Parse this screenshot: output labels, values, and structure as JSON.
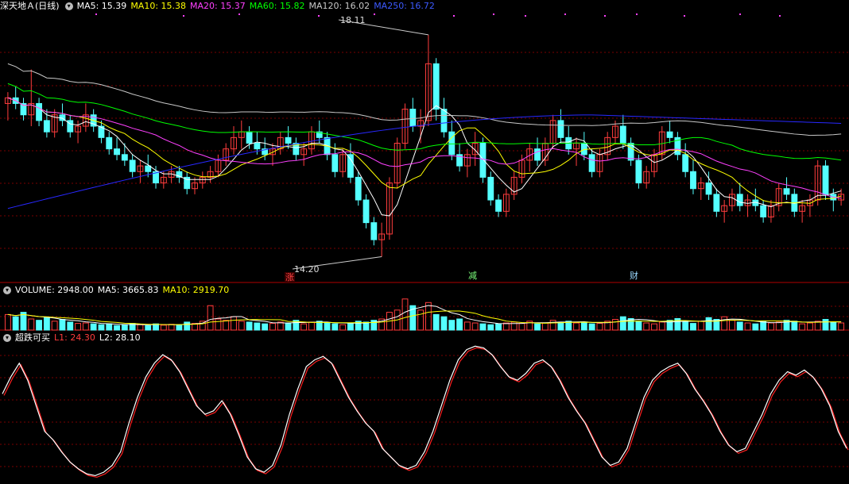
{
  "header": {
    "stock_name": "深天地Ａ",
    "period": "(日线)",
    "ma5": "MA5: 15.39",
    "ma10": "MA10: 15.38",
    "ma20": "MA20: 15.37",
    "ma60": "MA60: 15.82",
    "ma120": "MA120: 16.02",
    "ma250": "MA250: 16.72"
  },
  "volume_header": {
    "title": "VOLUME: 2948.00",
    "ma5": "MA5: 3665.83",
    "ma10": "MA10: 2919.70"
  },
  "indicator_header": {
    "title": "超跌可买",
    "l1": "L1: 24.30",
    "l2": "L2: 28.10"
  },
  "price_labels": {
    "high": "18.11",
    "low": "14.20"
  },
  "events": [
    {
      "label": "涨",
      "color": "#ff4444"
    },
    {
      "label": "减",
      "color": "#7cff7c"
    },
    {
      "label": "财",
      "color": "#9ad8ff"
    }
  ],
  "colors": {
    "up": "#ff3d3d",
    "down": "#54ffff",
    "ma5": "#ffffff",
    "ma10": "#ffff00",
    "ma20": "#ff40ff",
    "ma60": "#00ff00",
    "ma120": "#c8c8c8",
    "ma250": "#2828ff",
    "grid": "#7a0000"
  },
  "chart_data": {
    "type": "candlestick",
    "price_range": [
      13.9,
      18.5
    ],
    "high": 18.11,
    "low": 14.2,
    "candles": [
      [
        16.9,
        17.1,
        16.6,
        17.0
      ],
      [
        17.0,
        17.2,
        16.8,
        16.9
      ],
      [
        16.9,
        17.0,
        16.6,
        16.7
      ],
      [
        16.7,
        17.5,
        16.5,
        16.9
      ],
      [
        16.9,
        17.0,
        16.5,
        16.6
      ],
      [
        16.6,
        16.8,
        16.3,
        16.4
      ],
      [
        16.4,
        16.8,
        16.3,
        16.7
      ],
      [
        16.7,
        16.9,
        16.5,
        16.6
      ],
      [
        16.6,
        16.7,
        16.3,
        16.4
      ],
      [
        16.4,
        16.6,
        16.2,
        16.5
      ],
      [
        16.5,
        16.9,
        16.4,
        16.7
      ],
      [
        16.7,
        16.8,
        16.4,
        16.5
      ],
      [
        16.5,
        16.6,
        16.2,
        16.3
      ],
      [
        16.3,
        16.4,
        16.0,
        16.1
      ],
      [
        16.1,
        16.3,
        15.9,
        16.0
      ],
      [
        16.0,
        16.2,
        15.8,
        15.9
      ],
      [
        15.9,
        16.0,
        15.6,
        15.7
      ],
      [
        15.7,
        15.9,
        15.5,
        15.8
      ],
      [
        15.8,
        16.0,
        15.6,
        15.7
      ],
      [
        15.7,
        15.8,
        15.4,
        15.5
      ],
      [
        15.5,
        15.7,
        15.4,
        15.6
      ],
      [
        15.6,
        15.8,
        15.5,
        15.7
      ],
      [
        15.7,
        15.8,
        15.5,
        15.6
      ],
      [
        15.6,
        15.7,
        15.3,
        15.4
      ],
      [
        15.4,
        15.6,
        15.3,
        15.5
      ],
      [
        15.5,
        15.7,
        15.4,
        15.6
      ],
      [
        15.6,
        15.8,
        15.5,
        15.7
      ],
      [
        15.7,
        16.0,
        15.6,
        15.9
      ],
      [
        15.9,
        16.2,
        15.8,
        16.1
      ],
      [
        16.1,
        16.5,
        16.0,
        16.3
      ],
      [
        16.3,
        16.6,
        16.1,
        16.4
      ],
      [
        16.4,
        16.5,
        16.1,
        16.2
      ],
      [
        16.2,
        16.4,
        16.0,
        16.1
      ],
      [
        16.1,
        16.3,
        15.9,
        16.0
      ],
      [
        16.0,
        16.2,
        15.8,
        16.1
      ],
      [
        16.1,
        16.4,
        16.0,
        16.3
      ],
      [
        16.3,
        16.5,
        16.1,
        16.2
      ],
      [
        16.2,
        16.3,
        15.9,
        16.0
      ],
      [
        16.0,
        16.2,
        15.8,
        16.1
      ],
      [
        16.1,
        16.5,
        16.0,
        16.4
      ],
      [
        16.4,
        16.6,
        16.2,
        16.3
      ],
      [
        16.3,
        16.4,
        15.9,
        16.0
      ],
      [
        16.0,
        16.2,
        15.6,
        15.7
      ],
      [
        15.7,
        16.1,
        15.6,
        16.0
      ],
      [
        16.0,
        16.2,
        15.5,
        15.6
      ],
      [
        15.6,
        15.7,
        15.1,
        15.2
      ],
      [
        15.2,
        15.3,
        14.7,
        14.8
      ],
      [
        14.8,
        14.9,
        14.4,
        14.5
      ],
      [
        14.5,
        14.8,
        14.2,
        14.6
      ],
      [
        14.6,
        15.6,
        14.5,
        15.5
      ],
      [
        15.5,
        16.3,
        15.4,
        16.2
      ],
      [
        16.2,
        16.9,
        16.1,
        16.8
      ],
      [
        16.8,
        17.0,
        16.4,
        16.5
      ],
      [
        16.5,
        16.8,
        16.2,
        16.6
      ],
      [
        16.6,
        18.11,
        16.5,
        17.6
      ],
      [
        17.6,
        17.7,
        16.6,
        16.8
      ],
      [
        16.8,
        17.0,
        16.3,
        16.4
      ],
      [
        16.4,
        16.6,
        15.9,
        16.0
      ],
      [
        16.0,
        16.2,
        15.7,
        15.8
      ],
      [
        15.8,
        16.1,
        15.6,
        16.0
      ],
      [
        16.0,
        16.4,
        15.8,
        16.2
      ],
      [
        16.2,
        16.3,
        15.5,
        15.6
      ],
      [
        15.6,
        15.7,
        15.1,
        15.2
      ],
      [
        15.2,
        15.3,
        14.9,
        15.0
      ],
      [
        15.0,
        15.4,
        14.9,
        15.3
      ],
      [
        15.3,
        15.7,
        15.2,
        15.6
      ],
      [
        15.6,
        16.0,
        15.5,
        15.9
      ],
      [
        15.9,
        16.2,
        15.7,
        16.1
      ],
      [
        16.1,
        16.3,
        15.8,
        15.9
      ],
      [
        15.9,
        16.3,
        15.8,
        16.2
      ],
      [
        16.2,
        16.7,
        16.1,
        16.6
      ],
      [
        16.6,
        16.8,
        16.2,
        16.3
      ],
      [
        16.3,
        16.5,
        16.0,
        16.1
      ],
      [
        16.1,
        16.3,
        15.8,
        16.2
      ],
      [
        16.2,
        16.4,
        15.9,
        16.0
      ],
      [
        16.0,
        16.1,
        15.6,
        15.7
      ],
      [
        15.7,
        16.1,
        15.6,
        16.0
      ],
      [
        16.0,
        16.4,
        15.9,
        16.3
      ],
      [
        16.3,
        16.6,
        16.2,
        16.5
      ],
      [
        16.5,
        16.7,
        16.1,
        16.2
      ],
      [
        16.2,
        16.3,
        15.8,
        15.9
      ],
      [
        15.9,
        16.0,
        15.4,
        15.5
      ],
      [
        15.5,
        15.8,
        15.4,
        15.7
      ],
      [
        15.7,
        16.1,
        15.6,
        16.0
      ],
      [
        16.0,
        16.5,
        15.9,
        16.4
      ],
      [
        16.4,
        16.6,
        16.2,
        16.3
      ],
      [
        16.3,
        16.4,
        15.9,
        16.0
      ],
      [
        16.0,
        16.2,
        15.6,
        15.7
      ],
      [
        15.7,
        15.9,
        15.3,
        15.4
      ],
      [
        15.4,
        15.6,
        15.2,
        15.5
      ],
      [
        15.5,
        15.7,
        15.2,
        15.3
      ],
      [
        15.3,
        15.4,
        14.9,
        15.0
      ],
      [
        15.0,
        15.2,
        14.8,
        15.1
      ],
      [
        15.1,
        15.4,
        15.0,
        15.3
      ],
      [
        15.3,
        15.5,
        15.0,
        15.1
      ],
      [
        15.1,
        15.3,
        14.9,
        15.2
      ],
      [
        15.2,
        15.4,
        15.0,
        15.1
      ],
      [
        15.1,
        15.2,
        14.8,
        14.9
      ],
      [
        14.9,
        15.2,
        14.8,
        15.1
      ],
      [
        15.1,
        15.5,
        15.0,
        15.4
      ],
      [
        15.4,
        15.6,
        15.2,
        15.3
      ],
      [
        15.3,
        15.4,
        14.9,
        15.0
      ],
      [
        15.0,
        15.2,
        14.8,
        15.1
      ],
      [
        15.1,
        15.3,
        14.9,
        15.2
      ],
      [
        15.2,
        15.9,
        15.1,
        15.8
      ],
      [
        15.8,
        15.9,
        15.2,
        15.3
      ],
      [
        15.3,
        15.4,
        15.0,
        15.2
      ],
      [
        15.2,
        15.4,
        15.1,
        15.3
      ]
    ],
    "volume": [
      35,
      30,
      40,
      25,
      22,
      28,
      20,
      24,
      18,
      15,
      16,
      14,
      12,
      14,
      10,
      12,
      15,
      12,
      10,
      14,
      11,
      13,
      12,
      18,
      15,
      20,
      55,
      25,
      22,
      30,
      20,
      18,
      16,
      14,
      15,
      18,
      16,
      22,
      14,
      18,
      20,
      16,
      14,
      12,
      16,
      20,
      18,
      22,
      25,
      40,
      45,
      70,
      55,
      45,
      62,
      35,
      30,
      22,
      25,
      18,
      16,
      14,
      12,
      14,
      16,
      18,
      15,
      20,
      14,
      16,
      22,
      18,
      20,
      16,
      18,
      14,
      15,
      20,
      24,
      30,
      26,
      20,
      16,
      14,
      18,
      22,
      26,
      18,
      15,
      20,
      28,
      24,
      30,
      22,
      18,
      16,
      14,
      20,
      16,
      18,
      22,
      20,
      14,
      16,
      20,
      24,
      18,
      16
    ],
    "oscillator": [
      52,
      62,
      70,
      60,
      45,
      30,
      25,
      18,
      12,
      8,
      5,
      4,
      6,
      10,
      18,
      35,
      50,
      62,
      70,
      75,
      72,
      65,
      55,
      45,
      40,
      42,
      48,
      40,
      28,
      15,
      8,
      6,
      10,
      22,
      40,
      55,
      68,
      72,
      74,
      70,
      60,
      50,
      42,
      35,
      30,
      20,
      15,
      10,
      8,
      10,
      18,
      30,
      45,
      60,
      72,
      78,
      80,
      79,
      75,
      68,
      62,
      60,
      64,
      70,
      72,
      68,
      60,
      50,
      42,
      35,
      25,
      15,
      10,
      12,
      20,
      35,
      50,
      60,
      65,
      68,
      70,
      64,
      55,
      48,
      40,
      30,
      22,
      18,
      20,
      30,
      40,
      52,
      60,
      65,
      63,
      66,
      62,
      55,
      45,
      30,
      20
    ]
  }
}
